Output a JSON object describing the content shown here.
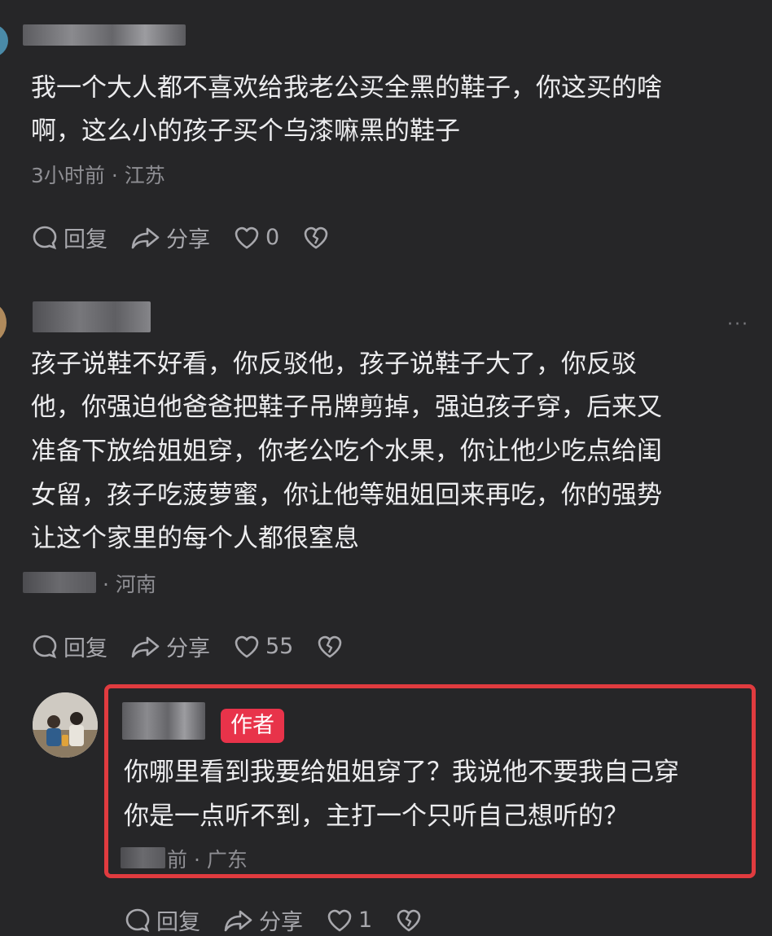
{
  "comments": [
    {
      "text_lines": [
        "我一个大人都不喜欢给我老公买全黑的鞋子，你这买的啥",
        "啊，这么小的孩子买个乌漆嘛黑的鞋子"
      ],
      "meta": "3小时前 · 江苏",
      "reply_label": "回复",
      "share_label": "分享",
      "likes": "0"
    },
    {
      "more": "···",
      "text_lines": [
        "孩子说鞋不好看，你反驳他，孩子说鞋子大了，你反驳",
        "他，你强迫他爸爸把鞋子吊牌剪掉，强迫孩子穿，后来又",
        "准备下放给姐姐穿，你老公吃个水果，你让他少吃点给闺",
        "女留，孩子吃菠萝蜜，你让他等姐姐回来再吃，你的强势",
        "让这个家里的每个人都很窒息"
      ],
      "meta": "· 河南",
      "reply_label": "回复",
      "share_label": "分享",
      "likes": "55"
    }
  ],
  "reply": {
    "badge": "作者",
    "text_lines": [
      "你哪里看到我要给姐姐穿了？我说他不要我自己穿",
      "你是一点听不到，主打一个只听自己想听的？"
    ],
    "meta_partial": "前",
    "meta": "· 广东",
    "reply_label": "回复",
    "share_label": "分享",
    "likes": "1"
  },
  "colors": {
    "background": "#262628",
    "highlight": "#e03b3f",
    "badge": "#e8334a"
  }
}
